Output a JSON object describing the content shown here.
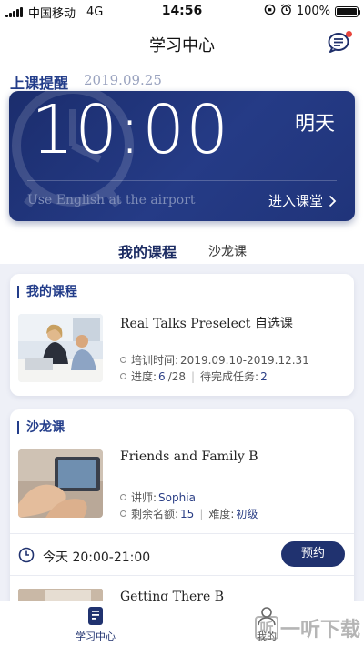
{
  "status_bar": {
    "carrier": "中国移动",
    "network": "4G",
    "time": "14:56",
    "battery": "100%"
  },
  "header": {
    "title": "学习中心"
  },
  "reminder": {
    "label": "上课提醒",
    "date": "2019.09.25"
  },
  "next_class": {
    "time": "10:00",
    "day": "明天",
    "topic": "Use English at the airport",
    "enter_label": "进入课堂"
  },
  "tabs": {
    "mine": "我的课程",
    "salon": "沙龙课"
  },
  "my_course": {
    "section_title": "我的课程",
    "title": "Real Talks Preselect 自选课",
    "period_label": "培训时间:",
    "period_value": "2019.09.10-2019.12.31",
    "progress_label": "进度:",
    "progress_done": "6",
    "progress_total": "/28",
    "pending_label": "待完成任务:",
    "pending_value": "2"
  },
  "salon": {
    "section_title": "沙龙课",
    "items": [
      {
        "title": "Friends and Family B",
        "teacher_label": "讲师:",
        "teacher": "Sophia",
        "seats_label": "剩余名额:",
        "seats": "15",
        "level_label": "难度:",
        "level": "初级",
        "slot": "今天 20:00-21:00",
        "book_label": "预约"
      },
      {
        "title": "Getting There B"
      }
    ]
  },
  "tabbar": {
    "study": "学习中心",
    "mine": "我的"
  },
  "watermark": {
    "box": "听",
    "text": "一听下载"
  },
  "colors": {
    "accent": "#233d8a",
    "card_bg": "#20347a",
    "button": "#20326f"
  }
}
